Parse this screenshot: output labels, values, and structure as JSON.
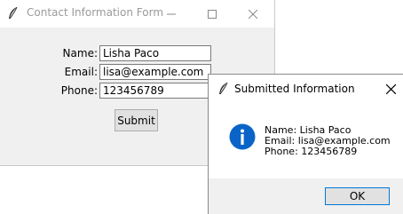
{
  "main_window": {
    "title": "Contact Information Form",
    "controls": {
      "minimize": "minimize-icon",
      "maximize": "maximize-icon",
      "close": "close-icon"
    },
    "form": {
      "name_label": "Name:",
      "name_value": "Lisha Paco",
      "email_label": "Email:",
      "email_value": "lisa@example.com",
      "phone_label": "Phone:",
      "phone_value": "123456789",
      "submit_label": "Submit"
    }
  },
  "dialog": {
    "title": "Submitted Information",
    "icon": "info-icon",
    "lines": [
      "Name: Lisha Paco",
      "Email: lisa@example.com",
      "Phone: 123456789"
    ],
    "ok_label": "OK"
  },
  "colors": {
    "info_icon": "#0a64c8",
    "ok_focus_border": "#0078d7",
    "window_bg": "#f0f0f0"
  }
}
